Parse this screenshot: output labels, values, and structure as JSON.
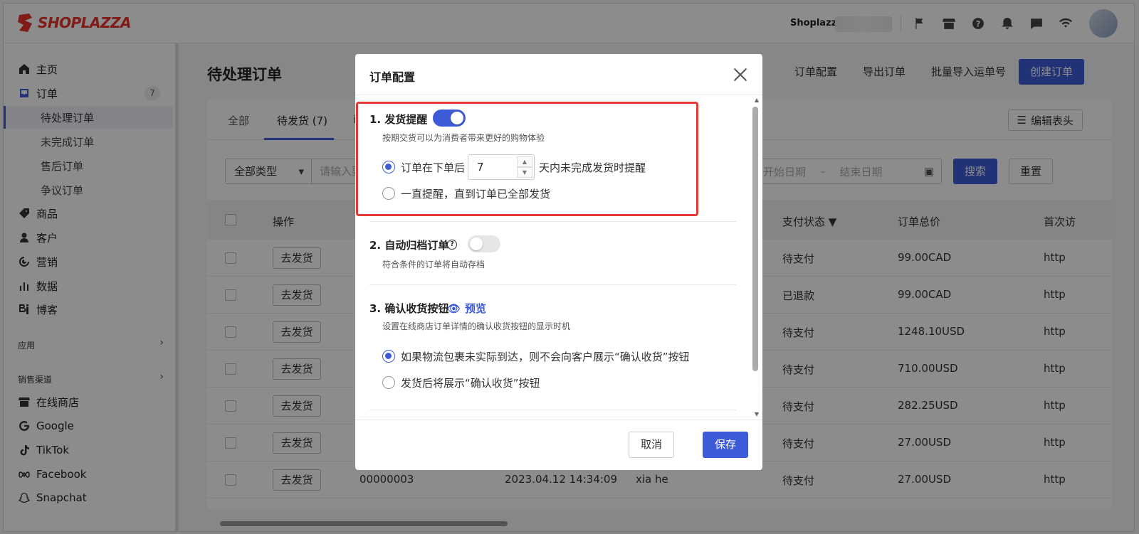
{
  "topbar": {
    "brand": "SHOPLAZZA",
    "store_name": "Shoplazza",
    "icons": [
      "flag-icon",
      "store-icon",
      "help-icon",
      "bell-icon",
      "message-icon",
      "wifi-icon"
    ]
  },
  "sidebar": {
    "items": [
      {
        "label": "主页",
        "icon": "home-icon"
      },
      {
        "label": "订单",
        "icon": "inbox-icon",
        "badge": "7"
      },
      {
        "label": "待处理订单",
        "active": true
      },
      {
        "label": "未完成订单"
      },
      {
        "label": "售后订单"
      },
      {
        "label": "争议订单"
      },
      {
        "label": "商品",
        "icon": "tag-icon"
      },
      {
        "label": "客户",
        "icon": "user-icon"
      },
      {
        "label": "营销",
        "icon": "marketing-icon"
      },
      {
        "label": "数据",
        "icon": "chart-icon"
      },
      {
        "label": "博客",
        "icon": "blog-icon"
      }
    ],
    "apps_label": "应用",
    "channels_label": "销售渠道",
    "channels": [
      {
        "label": "在线商店",
        "icon": "store-icon"
      },
      {
        "label": "Google",
        "icon": "google-icon"
      },
      {
        "label": "TikTok",
        "icon": "tiktok-icon"
      },
      {
        "label": "Facebook",
        "icon": "meta-icon"
      },
      {
        "label": "Snapchat",
        "icon": "snapchat-icon"
      }
    ]
  },
  "main": {
    "title": "待处理订单",
    "actions": [
      "订单配置",
      "导出订单",
      "批量导入运单号"
    ],
    "create_button": "创建订单",
    "tabs": [
      "全部",
      "待发货 (7)",
      "i"
    ],
    "edit_columns": "编辑表头",
    "filter_type": "全部类型",
    "search_placeholder": "请输入要",
    "date_start": "开始日期",
    "date_sep": "–",
    "date_end": "结束日期",
    "search_button": "搜索",
    "reset_button": "重置",
    "columns": [
      "操作",
      "支付状态 ▼",
      "订单总价",
      "首次访"
    ],
    "ship_label": "去发货",
    "rows": [
      {
        "pay_status": "待支付",
        "total": "99.00CAD",
        "link": "http"
      },
      {
        "pay_status": "已退款",
        "total": "99.00CAD",
        "link": "http"
      },
      {
        "pay_status": "待支付",
        "total": "1248.10USD",
        "link": "http"
      },
      {
        "pay_status": "待支付",
        "total": "710.00USD",
        "link": "http"
      },
      {
        "pay_status": "待支付",
        "total": "282.25USD",
        "link": "http"
      },
      {
        "pay_status": "待支付",
        "total": "27.00USD",
        "link": "http"
      },
      {
        "order_no": "00000003",
        "date": "2023.04.12 14:34:09",
        "customer": "xia he",
        "pay_status": "待支付",
        "total": "27.00USD",
        "link": "http"
      }
    ]
  },
  "modal": {
    "title": "订单配置",
    "section1": {
      "title": "1. 发货提醒",
      "enabled": true,
      "desc": "按期交货可以为消费者带来更好的购物体验",
      "option1_prefix": "订单在下单后",
      "days": "7",
      "option1_suffix": "天内未完成发货时提醒",
      "option2": "一直提醒，直到订单已全部发货"
    },
    "section2": {
      "title": "2. 自动归档订单",
      "enabled": false,
      "desc": "符合条件的订单将自动存档"
    },
    "section3": {
      "title": "3. 确认收货按钮",
      "preview": "预览",
      "desc": "设置在线商店订单详情的确认收货按钮的显示时机",
      "option1": "如果物流包裹未实际到达，则不会向客户展示“确认收货”按钮",
      "option2": "发货后将展示“确认收货”按钮"
    },
    "cancel": "取消",
    "save": "保存"
  },
  "colors": {
    "primary": "#3d5bd9",
    "brand": "#e8342d",
    "highlight": "#e53935"
  }
}
